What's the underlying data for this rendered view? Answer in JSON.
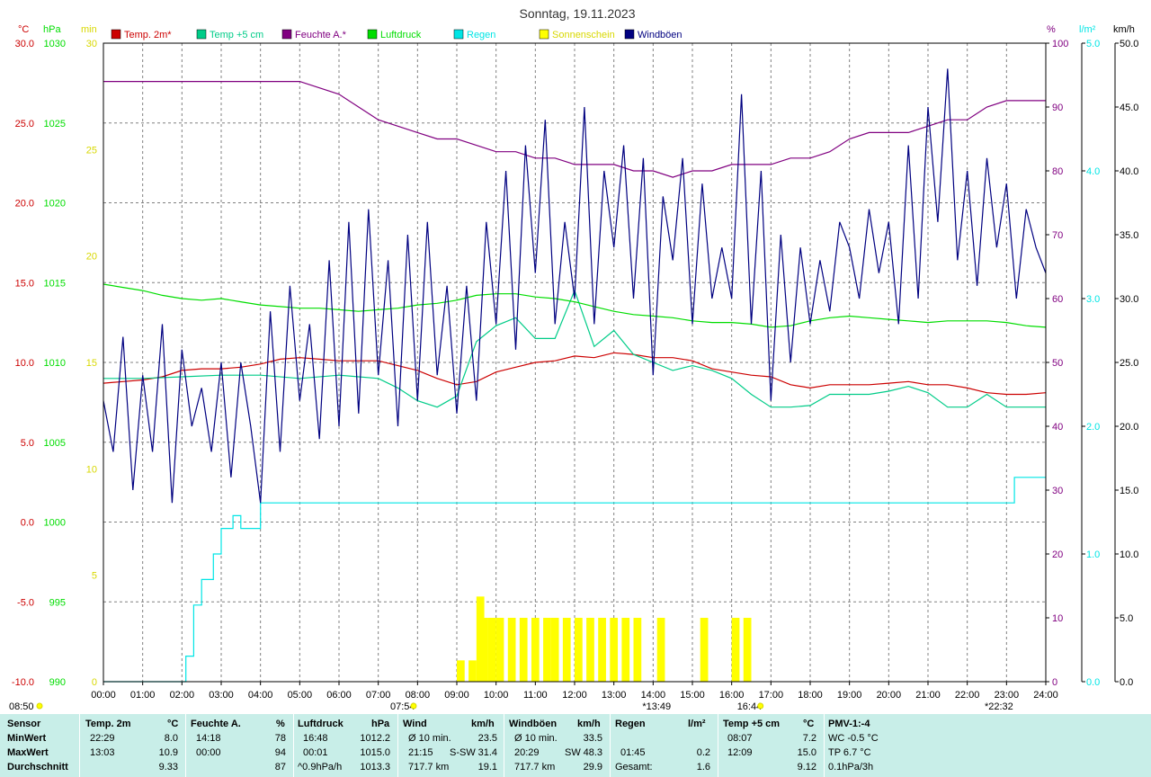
{
  "colors": {
    "temp2m": "#cc0000",
    "temp5cm": "#00cc88",
    "humidity": "#800080",
    "pressure": "#00dd00",
    "rain": "#00e5e5",
    "sunshine": "#ffff00",
    "gusts": "#000080",
    "grid": "#808080",
    "stats_bg": "#c8eee8"
  },
  "stats": {
    "headers": {
      "sensor": "Sensor",
      "temp": "Temp. 2m",
      "temp_unit": "°C",
      "hum": "Feuchte A.",
      "hum_unit": "%",
      "press": "Luftdruck",
      "press_unit": "hPa",
      "wind": "Wind",
      "wind_unit": "km/h",
      "gust": "Windböen",
      "gust_unit": "km/h",
      "rain": "Regen",
      "rain_unit": "l/m²",
      "t5": "Temp +5 cm",
      "t5_unit": "°C",
      "pmv": "PMV-1:-4"
    },
    "rows": {
      "min": {
        "label": "MinWert",
        "temp_time": "22:29",
        "temp_val": "8.0",
        "hum_time": "14:18",
        "hum_val": "78",
        "press_time": "16:48",
        "press_val": "1012.2",
        "wind_time": "Ø 10 min.",
        "wind_val": "23.5",
        "gust_time": "Ø 10 min.",
        "gust_val": "33.5",
        "t5_time": "08:07",
        "t5_val": "7.2",
        "pmv": "WC -0.5 °C"
      },
      "max": {
        "label": "MaxWert",
        "temp_time": "13:03",
        "temp_val": "10.9",
        "hum_time": "00:00",
        "hum_val": "94",
        "press_time": "00:01",
        "press_val": "1015.0",
        "wind_time": "21:15",
        "wind_dir": "S-SW",
        "wind_val": "31.4",
        "gust_time": "20:29",
        "gust_dir": "SW",
        "gust_val": "48.3",
        "rain_time": "01:45",
        "rain_val": "0.2",
        "t5_time": "12:09",
        "t5_val": "15.0",
        "pmv": "TP 6.7 °C"
      },
      "avg": {
        "label": "Durchschnitt",
        "temp_val": "9.33",
        "hum_val": "87",
        "press_trend": "^0.9hPa/h",
        "press_val": "1013.3",
        "wind_km": "717.7 km",
        "wind_val": "19.1",
        "gust_km": "717.7 km",
        "gust_val": "29.9",
        "rain_label": "Gesamt:",
        "rain_val": "1.6",
        "t5_val": "9.12",
        "pmv": "0.1hPa/3h"
      }
    }
  },
  "chart_data": {
    "type": "line",
    "title": "Sonntag, 19.11.2023",
    "x_unit": "hours",
    "xlim": [
      0,
      24
    ],
    "x_ticks": [
      "00:00",
      "01:00",
      "02:00",
      "03:00",
      "04:00",
      "05:00",
      "06:00",
      "07:00",
      "08:00",
      "09:00",
      "10:00",
      "11:00",
      "12:00",
      "13:00",
      "14:00",
      "15:00",
      "16:00",
      "17:00",
      "18:00",
      "19:00",
      "20:00",
      "21:00",
      "22:00",
      "23:00",
      "24:00"
    ],
    "grid": true,
    "axes": {
      "temp": {
        "unit": "°C",
        "range": [
          -10,
          30
        ],
        "ticks": [
          "-10.0",
          "-5.0",
          "0.0",
          "5.0",
          "10.0",
          "15.0",
          "20.0",
          "25.0",
          "30.0"
        ]
      },
      "pressure": {
        "unit": "hPa",
        "range": [
          990,
          1030
        ],
        "ticks": [
          "990",
          "995",
          "1000",
          "1005",
          "1010",
          "1015",
          "1020",
          "1025",
          "1030"
        ]
      },
      "sunshine": {
        "unit": "min",
        "range": [
          0,
          30
        ],
        "ticks": [
          "0",
          "5",
          "10",
          "15",
          "20",
          "25",
          "30"
        ]
      },
      "humidity": {
        "unit": "%",
        "range": [
          0,
          100
        ],
        "ticks": [
          "0",
          "10",
          "20",
          "30",
          "40",
          "50",
          "60",
          "70",
          "80",
          "90",
          "100"
        ]
      },
      "rain": {
        "unit": "l/m²",
        "range": [
          0,
          5
        ],
        "ticks": [
          "0.0",
          "1.0",
          "2.0",
          "3.0",
          "4.0",
          "5.0"
        ]
      },
      "wind": {
        "unit": "km/h",
        "range": [
          0,
          50
        ],
        "ticks": [
          "0.0",
          "5.0",
          "10.0",
          "15.0",
          "20.0",
          "25.0",
          "30.0",
          "35.0",
          "40.0",
          "45.0",
          "50.0"
        ]
      }
    },
    "legend": [
      "Temp. 2m*",
      "Temp +5 cm",
      "Feuchte A.*",
      "Luftdruck",
      "Regen",
      "Sonnenschein",
      "Windböen"
    ],
    "legend_position": "top",
    "sun_events": {
      "sunrise": "07:54",
      "sunset": "16:44",
      "max_sun": "13:49",
      "moon": "22:32",
      "below_left": "08:50"
    },
    "series": [
      {
        "name": "Temp. 2m*",
        "axis": "temp",
        "x": [
          0,
          0.5,
          1,
          1.5,
          2,
          2.5,
          3,
          3.5,
          4,
          4.5,
          5,
          5.5,
          6,
          6.5,
          7,
          7.5,
          8,
          8.5,
          9,
          9.5,
          10,
          10.5,
          11,
          11.5,
          12,
          12.5,
          13,
          13.5,
          14,
          14.5,
          15,
          15.5,
          16,
          16.5,
          17,
          17.5,
          18,
          18.5,
          19,
          19.5,
          20,
          20.5,
          21,
          21.5,
          22,
          22.5,
          23,
          23.5,
          24
        ],
        "y": [
          8.7,
          8.8,
          8.9,
          9.1,
          9.5,
          9.6,
          9.6,
          9.7,
          9.9,
          10.2,
          10.3,
          10.2,
          10.1,
          10.1,
          10.1,
          9.8,
          9.5,
          9.0,
          8.6,
          8.8,
          9.4,
          9.7,
          10.0,
          10.1,
          10.4,
          10.3,
          10.6,
          10.5,
          10.3,
          10.3,
          10.1,
          9.6,
          9.4,
          9.2,
          9.1,
          8.6,
          8.4,
          8.6,
          8.6,
          8.6,
          8.7,
          8.8,
          8.6,
          8.6,
          8.4,
          8.1,
          8.0,
          8.0,
          8.1
        ]
      },
      {
        "name": "Temp +5 cm",
        "axis": "temp",
        "x": [
          0,
          1,
          2,
          3,
          4,
          5,
          6,
          7,
          7.5,
          8,
          8.5,
          9,
          9.5,
          10,
          10.5,
          11,
          11.5,
          12,
          12.5,
          13,
          13.5,
          14,
          14.5,
          15,
          15.5,
          16,
          16.5,
          17,
          17.5,
          18,
          18.5,
          19,
          19.5,
          20,
          20.5,
          21,
          21.5,
          22,
          22.5,
          23,
          23.5,
          24
        ],
        "y": [
          9.0,
          9.0,
          9.1,
          9.2,
          9.2,
          9.0,
          9.2,
          9.0,
          8.4,
          7.6,
          7.2,
          7.9,
          11.3,
          12.3,
          12.8,
          11.5,
          11.5,
          14.5,
          11.0,
          12.0,
          10.5,
          10.0,
          9.5,
          9.8,
          9.5,
          9.0,
          8.0,
          7.2,
          7.2,
          7.3,
          8.0,
          8.0,
          8.0,
          8.2,
          8.5,
          8.1,
          7.2,
          7.2,
          8.0,
          7.2,
          7.2,
          7.2
        ]
      },
      {
        "name": "Feuchte A.*",
        "axis": "humidity",
        "x": [
          0,
          1,
          2,
          3,
          4,
          5,
          5.5,
          6,
          6.5,
          7,
          7.5,
          8,
          8.5,
          9,
          9.5,
          10,
          10.5,
          11,
          11.5,
          12,
          12.5,
          13,
          13.5,
          14,
          14.5,
          15,
          15.5,
          16,
          16.5,
          17,
          17.5,
          18,
          18.5,
          19,
          19.5,
          20,
          20.5,
          21,
          21.5,
          22,
          22.5,
          23,
          23.5,
          24
        ],
        "y": [
          94,
          94,
          94,
          94,
          94,
          94,
          93,
          92,
          90,
          88,
          87,
          86,
          85,
          85,
          84,
          83,
          83,
          82,
          82,
          81,
          81,
          81,
          80,
          80,
          79,
          80,
          80,
          81,
          81,
          81,
          82,
          82,
          83,
          85,
          86,
          86,
          86,
          87,
          88,
          88,
          90,
          91,
          91,
          91
        ]
      },
      {
        "name": "Luftdruck",
        "axis": "pressure",
        "x": [
          0,
          0.5,
          1,
          1.5,
          2,
          2.5,
          3,
          3.5,
          4,
          4.5,
          5,
          5.5,
          6,
          6.5,
          7,
          7.5,
          8,
          8.5,
          9,
          9.5,
          10,
          10.5,
          11,
          11.5,
          12,
          12.5,
          13,
          13.5,
          14,
          14.5,
          15,
          15.5,
          16,
          16.5,
          17,
          17.5,
          18,
          18.5,
          19,
          19.5,
          20,
          20.5,
          21,
          21.5,
          22,
          22.5,
          23,
          23.5,
          24
        ],
        "y": [
          1014.9,
          1014.7,
          1014.5,
          1014.2,
          1014.0,
          1013.9,
          1014.0,
          1013.8,
          1013.6,
          1013.5,
          1013.4,
          1013.4,
          1013.3,
          1013.2,
          1013.3,
          1013.4,
          1013.6,
          1013.7,
          1013.9,
          1014.2,
          1014.3,
          1014.3,
          1014.1,
          1014.0,
          1013.8,
          1013.5,
          1013.2,
          1013.0,
          1012.9,
          1012.8,
          1012.6,
          1012.5,
          1012.5,
          1012.4,
          1012.2,
          1012.3,
          1012.6,
          1012.8,
          1012.9,
          1012.8,
          1012.7,
          1012.6,
          1012.5,
          1012.6,
          1012.6,
          1012.6,
          1012.5,
          1012.3,
          1012.2
        ]
      },
      {
        "name": "Regen",
        "axis": "rain",
        "x": [
          0,
          1.7,
          2.1,
          2.3,
          2.5,
          2.8,
          3.0,
          3.3,
          3.5,
          3.9,
          4.0,
          4.1,
          23.0,
          23.1,
          23.2,
          24
        ],
        "y": [
          0,
          0,
          0.2,
          0.6,
          0.8,
          1.0,
          1.2,
          1.3,
          1.2,
          1.2,
          1.4,
          1.4,
          1.4,
          1.4,
          1.6,
          1.6
        ]
      },
      {
        "name": "Sonnenschein",
        "axis": "sunshine",
        "x": [
          8.0,
          9.0,
          9.3,
          9.5,
          9.6,
          9.8,
          10.0,
          10.3,
          10.6,
          10.9,
          11.2,
          11.4,
          11.7,
          12.0,
          12.3,
          12.6,
          12.9,
          13.2,
          13.5,
          13.8,
          14.1,
          14.4,
          14.8,
          15.2,
          15.6,
          16.0,
          16.3,
          16.6
        ],
        "y": [
          0,
          1,
          1,
          4,
          3,
          3,
          3,
          3,
          3,
          3,
          3,
          3,
          3,
          3,
          3,
          3,
          3,
          3,
          3,
          0,
          3,
          0,
          0,
          3,
          0,
          3,
          3,
          0
        ]
      },
      {
        "name": "Windböen",
        "axis": "wind",
        "x": [
          0,
          0.25,
          0.5,
          0.75,
          1,
          1.25,
          1.5,
          1.75,
          2,
          2.25,
          2.5,
          2.75,
          3,
          3.25,
          3.5,
          3.75,
          4,
          4.25,
          4.5,
          4.75,
          5,
          5.25,
          5.5,
          5.75,
          6,
          6.25,
          6.5,
          6.75,
          7,
          7.25,
          7.5,
          7.75,
          8,
          8.25,
          8.5,
          8.75,
          9,
          9.25,
          9.5,
          9.75,
          10,
          10.25,
          10.5,
          10.75,
          11,
          11.25,
          11.5,
          11.75,
          12,
          12.25,
          12.5,
          12.75,
          13,
          13.25,
          13.5,
          13.75,
          14,
          14.25,
          14.5,
          14.75,
          15,
          15.25,
          15.5,
          15.75,
          16,
          16.25,
          16.5,
          16.75,
          17,
          17.25,
          17.5,
          17.75,
          18,
          18.25,
          18.5,
          18.75,
          19,
          19.25,
          19.5,
          19.75,
          20,
          20.25,
          20.5,
          20.75,
          21,
          21.25,
          21.5,
          21.75,
          22,
          22.25,
          22.5,
          22.75,
          23,
          23.25,
          23.5,
          23.75,
          24
        ],
        "y": [
          22,
          18,
          27,
          15,
          24,
          18,
          28,
          14,
          26,
          20,
          23,
          18,
          25,
          16,
          25,
          20,
          14,
          29,
          18,
          31,
          22,
          28,
          19,
          33,
          20,
          36,
          21,
          37,
          24,
          33,
          20,
          35,
          22,
          36,
          24,
          31,
          21,
          31,
          22,
          36,
          28,
          40,
          26,
          42,
          32,
          44,
          28,
          36,
          30,
          45,
          28,
          40,
          34,
          42,
          30,
          41,
          24,
          38,
          33,
          41,
          28,
          39,
          30,
          34,
          30,
          46,
          28,
          40,
          22,
          35,
          25,
          34,
          28,
          33,
          29,
          36,
          34,
          30,
          37,
          32,
          36,
          28,
          42,
          30,
          45,
          36,
          48,
          33,
          40,
          31,
          41,
          34,
          39,
          30,
          37,
          34,
          32
        ]
      }
    ]
  }
}
